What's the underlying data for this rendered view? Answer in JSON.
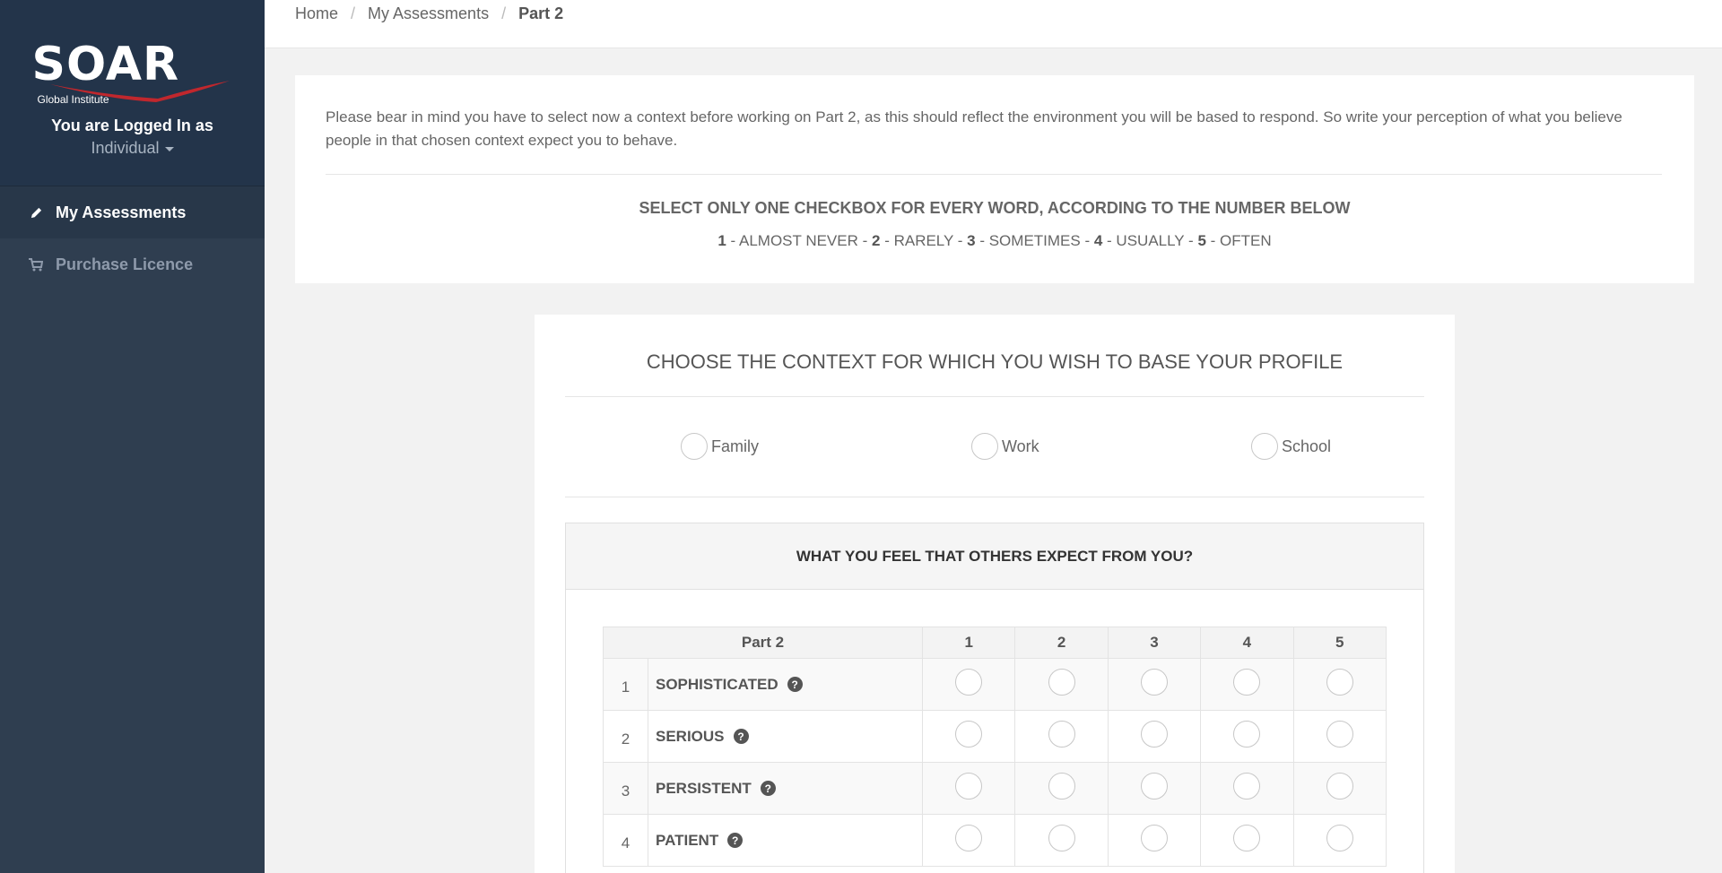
{
  "sidebar": {
    "logo_text": "SOAR",
    "logo_subtext": "Global Institute",
    "logged_in_label": "You are Logged In as",
    "role": "Individual",
    "nav": [
      {
        "label": "My Assessments",
        "icon": "pencil-icon",
        "active": true
      },
      {
        "label": "Purchase Licence",
        "icon": "cart-icon",
        "active": false
      }
    ]
  },
  "breadcrumb": [
    "Home",
    "My Assessments",
    "Part 2"
  ],
  "info": {
    "intro": "Please bear in mind you have to select now a context before working on Part 2, as this should reflect the environment you will be based to respond. So write your perception of what you believe people in that chosen context expect you to behave.",
    "instruction": "SELECT ONLY ONE CHECKBOX FOR EVERY WORD, ACCORDING TO THE NUMBER BELOW",
    "scale": [
      {
        "n": "1",
        "label": " - ALMOST NEVER - "
      },
      {
        "n": "2",
        "label": " - RARELY - "
      },
      {
        "n": "3",
        "label": " - SOMETIMES - "
      },
      {
        "n": "4",
        "label": " - USUALLY - "
      },
      {
        "n": "5",
        "label": " - OFTEN"
      }
    ]
  },
  "context": {
    "title": "CHOOSE THE CONTEXT FOR WHICH YOU WISH TO BASE YOUR PROFILE",
    "options": [
      "Family",
      "Work",
      "School"
    ]
  },
  "questions": {
    "heading": "WHAT YOU FEEL THAT OTHERS EXPECT FROM YOU?",
    "table_header": "Part 2",
    "columns": [
      "1",
      "2",
      "3",
      "4",
      "5"
    ],
    "rows": [
      {
        "num": "1",
        "word": "SOPHISTICATED"
      },
      {
        "num": "2",
        "word": "SERIOUS"
      },
      {
        "num": "3",
        "word": "PERSISTENT"
      },
      {
        "num": "4",
        "word": "PATIENT"
      }
    ]
  },
  "colors": {
    "sidebar": "#2f3e50",
    "sidebar_head": "#23344a",
    "accent": "#c0272d"
  }
}
